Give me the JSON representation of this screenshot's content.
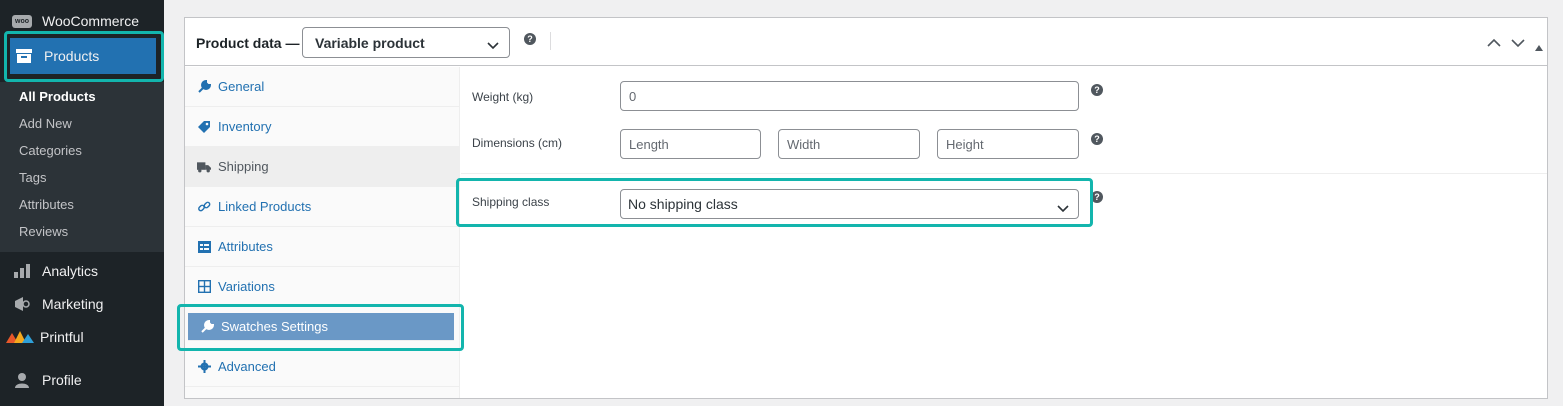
{
  "sidebar": {
    "woocommerce": "WooCommerce",
    "products": "Products",
    "submenu": [
      "All Products",
      "Add New",
      "Categories",
      "Tags",
      "Attributes",
      "Reviews"
    ],
    "analytics": "Analytics",
    "marketing": "Marketing",
    "printful": "Printful",
    "profile": "Profile",
    "woo_logo_text": "woo"
  },
  "product_data": {
    "title": "Product data —",
    "type_value": "Variable product",
    "help_icon": "?"
  },
  "tabs": [
    "General",
    "Inventory",
    "Shipping",
    "Linked Products",
    "Attributes",
    "Variations",
    "Swatches Settings",
    "Advanced"
  ],
  "shipping": {
    "weight_label": "Weight (kg)",
    "weight_placeholder": "0",
    "dimensions_label": "Dimensions (cm)",
    "length_placeholder": "Length",
    "width_placeholder": "Width",
    "height_placeholder": "Height",
    "class_label": "Shipping class",
    "class_value": "No shipping class"
  },
  "colors": {
    "highlight": "#13b5ad",
    "sidebar_bg": "#1d2327",
    "active_menu": "#2271b1",
    "swatch_tab": "#6a98c6"
  }
}
